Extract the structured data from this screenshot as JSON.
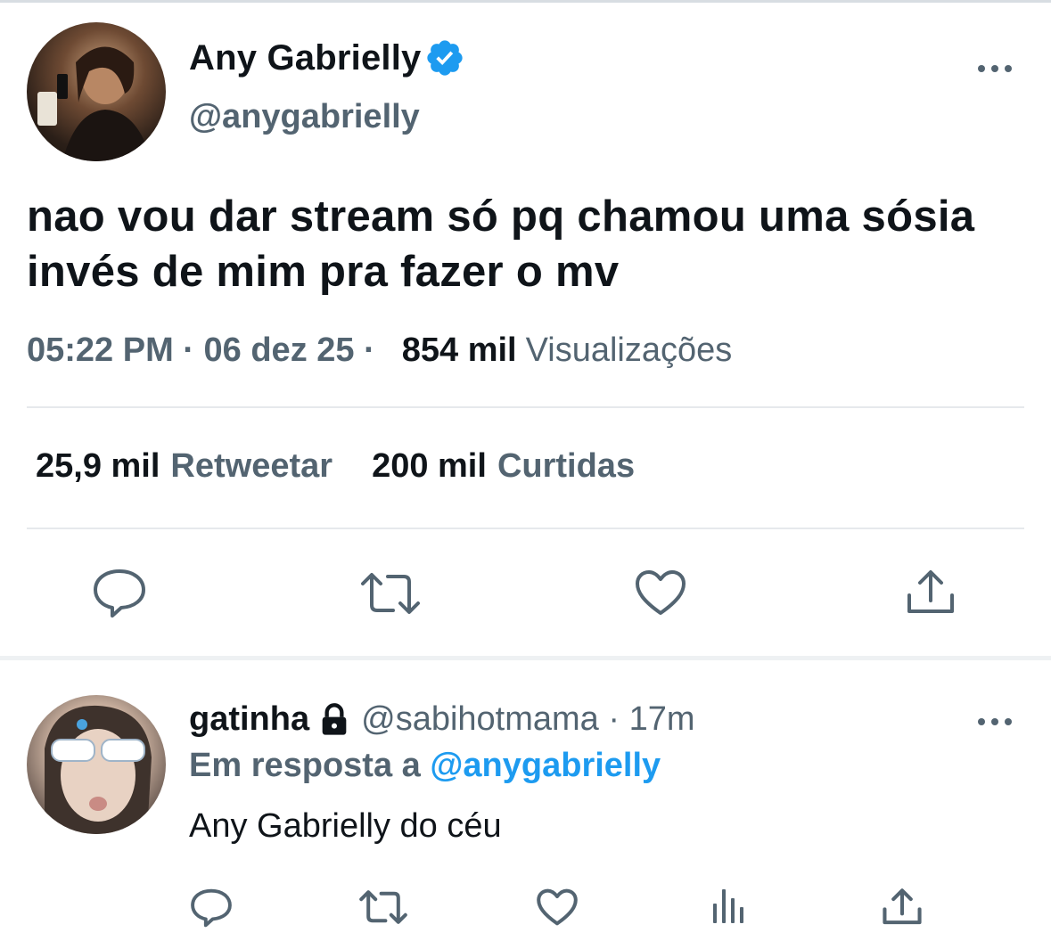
{
  "main_tweet": {
    "display_name": "Any Gabrielly",
    "handle": "@anygabrielly",
    "text": "nao vou dar stream só pq chamou uma sósia invés de mim pra fazer o mv",
    "time_date": "05:22 PM · 06 dez 25 ·",
    "views_count": "854 mil",
    "views_label": "Visualizações",
    "retweets_count": "25,9 mil",
    "retweets_label": "Retweetar",
    "likes_count": "200 mil",
    "likes_label": "Curtidas"
  },
  "reply": {
    "display_name": "gatinha",
    "handle_time": "@sabihotmama · 17m",
    "in_reply_to_label": "Em resposta a",
    "in_reply_to_handle": "@anygabrielly",
    "text": "Any Gabrielly do céu"
  },
  "icons": {
    "verified": "verified-badge-icon",
    "more": "more-dots-icon",
    "reply": "reply-bubble-icon",
    "retweet": "retweet-icon",
    "like": "heart-icon",
    "share": "share-icon",
    "analytics": "analytics-bars-icon",
    "lock": "lock-icon"
  },
  "colors": {
    "text_primary": "#0f1419",
    "text_secondary": "#536471",
    "accent": "#1d9bf0",
    "divider": "#e6e9ec"
  }
}
